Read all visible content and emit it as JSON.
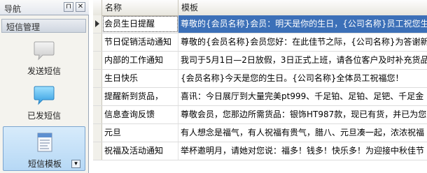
{
  "nav": {
    "title": "导航",
    "pin_glyph": "⊓",
    "close_glyph": "✕",
    "group": "短信管理",
    "items": [
      {
        "label": "发送短信",
        "icon": "gray-chat-bubble-icon"
      },
      {
        "label": "已发短信",
        "icon": "blue-chat-bubble-icon"
      },
      {
        "label": "短信模板",
        "icon": "document-template-icon"
      }
    ],
    "more_glyph": "▾"
  },
  "grid": {
    "columns": [
      "名称",
      "模板"
    ],
    "rows": [
      {
        "name": "会员生日提醒",
        "template": "尊敬的{会员名称}会员：明天是你的生日，{公司名称}员工祝您生"
      },
      {
        "name": "节日促销活动通知",
        "template": "尊敬的{会员名称}会员您好：在此佳节之际，{公司名称}为答谢新"
      },
      {
        "name": "内部的工作通知",
        "template": "我司于5月1日—2日放假，3日正式上班，请各位客户及时补充货品"
      },
      {
        "name": "生日快乐",
        "template": "{会员名称}今天是您的生日。{公司名称}全体员工祝福您！"
      },
      {
        "name": "提醒新到货品，",
        "template": "喜讯：今日展厅到大量完美pt999、千足铂、足铂、足钯、千足金"
      },
      {
        "name": "信息查询反馈",
        "template": "尊敬会员，您那边所需货品：银饰HT987款，现已有货，并已为您"
      },
      {
        "name": "元旦",
        "template": "有人想念是福气，有人祝福有贵气，腊八、元旦凑一起，浓浓祝福"
      },
      {
        "name": "祝福及活动通知",
        "template": "举杯邀明月，请她对您说：福多！钱多！快乐多！为迎接中秋佳节"
      }
    ],
    "selected_row": 0
  },
  "colors": {
    "selection": "#3c70b8",
    "nav_selected": "#b6d8f5"
  }
}
